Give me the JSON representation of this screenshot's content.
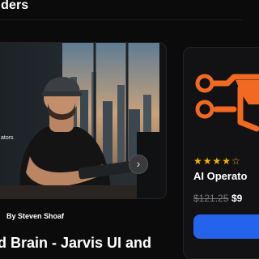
{
  "header": {
    "title": "ilders"
  },
  "card_left": {
    "photo_label": "ators",
    "carousel": {
      "count": 7,
      "active": 1
    },
    "seller_text": "By Steven Shoaf",
    "title": "nd Brain - Jarvis UI and"
  },
  "card_right": {
    "rating_text": "★★★★☆",
    "title": "AI Operato",
    "old_price": "$121.25",
    "new_price": "$9"
  },
  "colors": {
    "background": "#0b0b0c",
    "card": "#121214",
    "accent_orange": "#f26a21",
    "star_gold": "#f5b301",
    "buy_blue": "#2563eb"
  }
}
